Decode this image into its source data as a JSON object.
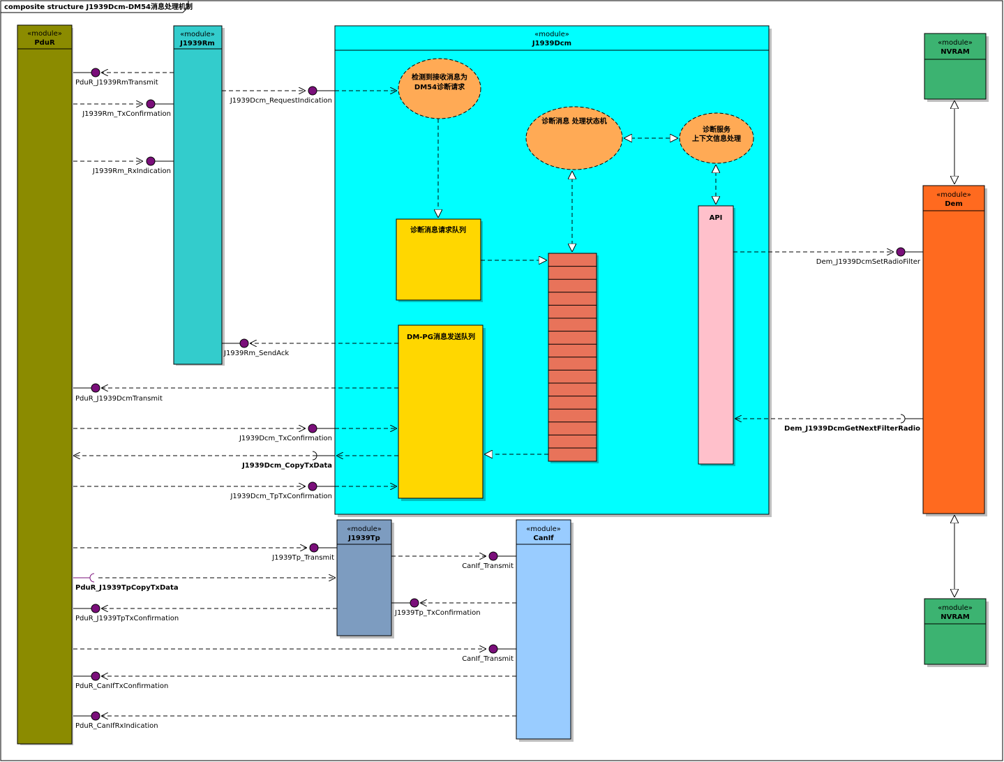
{
  "frame": {
    "title": "composite structure J1939Dcm-DM54消息处理机制"
  },
  "stereotype": "«module»",
  "modules": {
    "pdur": "PduR",
    "j1939rm": "J1939Rm",
    "j1939dcm": "J1939Dcm",
    "nvram": "NVRAM",
    "dem": "Dem",
    "j1939tp": "J1939Tp",
    "canif": "CanIf"
  },
  "elements": {
    "detect": [
      "检测到接收消息为",
      "DM54诊断请求"
    ],
    "state_machine": "诊断消息 处理状态机",
    "context": [
      "诊断服务",
      "上下文信息处理"
    ],
    "request_queue": "诊断消息请求队列",
    "send_queue": "DM-PG消息发送队列",
    "api": "API"
  },
  "ports": {
    "pdur_j1939rmtransmit": "PduR_J1939RmTransmit",
    "j1939rm_txconfirmation": "J1939Rm_TxConfirmation",
    "j1939rm_rxindication": "J1939Rm_RxIndication",
    "j1939dcm_requestindication": "J1939Dcm_RequestIndication",
    "j1939rm_sendack": "J1939Rm_SendAck",
    "pdur_j1939dcmtransmit": "PduR_J1939DcmTransmit",
    "j1939dcm_txconfirmation": "J1939Dcm_TxConfirmation",
    "j1939dcm_copytxdata": "J1939Dcm_CopyTxData",
    "j1939dcm_tptxconfirmation": "J1939Dcm_TpTxConfirmation",
    "dem_setradiofilter": "Dem_J1939DcmSetRadioFilter",
    "dem_getnextfilterradio": "Dem_J1939DcmGetNextFilterRadio",
    "j1939tp_transmit": "J1939Tp_Transmit",
    "canif_transmit_1": "CanIf_Transmit",
    "pdur_j1939tpcopytxdata": "PduR_J1939TpCopyTxData",
    "pdur_j1939tptxconfirmation": "PduR_J1939TpTxConfirmation",
    "j1939tp_txconfirmation": "J1939Tp_TxConfirmation",
    "canif_transmit_2": "CanIf_Transmit",
    "pdur_canif_txconfirmation": "PduR_CanIfTxConfirmation",
    "pdur_canif_rxindication": "PduR_CanIfRxIndication"
  },
  "colors": {
    "pdur": "#8b8b00",
    "j1939rm": "#33cccc",
    "j1939dcm": "#00ffff",
    "nvram": "#3cb371",
    "dem": "#ff6a1f",
    "j1939tp": "#7d9cc0",
    "canif": "#99ccff",
    "oval": "#ffaa55",
    "queue": "#ffd700",
    "queue_table": "#e8735a",
    "api": "#ffc0cb",
    "port": "#7a0f7a"
  }
}
